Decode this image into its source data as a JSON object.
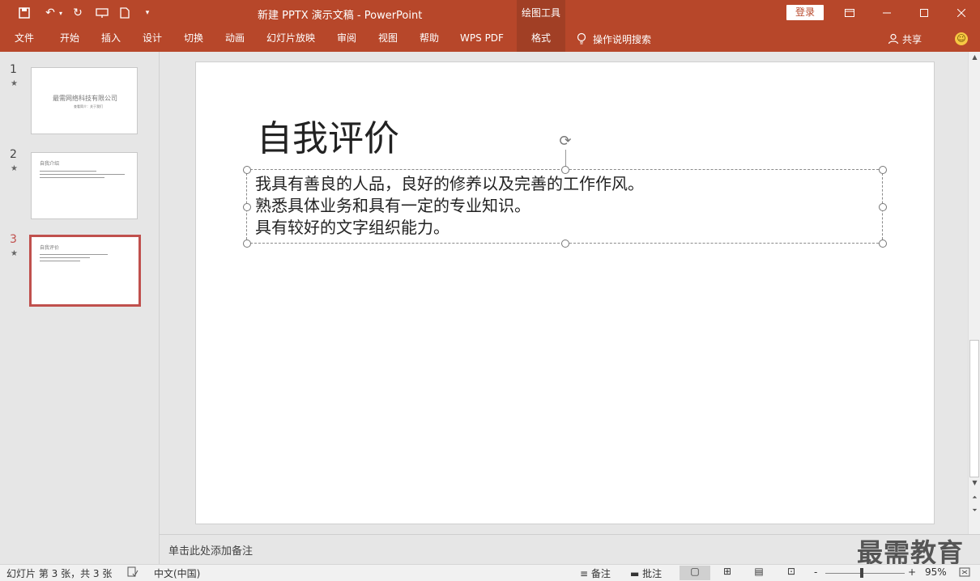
{
  "titlebar": {
    "title": "新建 PPTX 演示文稿 - PowerPoint",
    "context_tab": "绘图工具",
    "login": "登录",
    "quick_access": [
      "save-icon",
      "undo-icon",
      "redo-icon",
      "present-icon",
      "new-file-icon",
      "customize-icon"
    ],
    "window_buttons": [
      "ribbon-display-icon",
      "minimize-icon",
      "maximize-icon",
      "close-icon"
    ]
  },
  "ribbon": {
    "tabs": [
      "文件",
      "开始",
      "插入",
      "设计",
      "切换",
      "动画",
      "幻灯片放映",
      "审阅",
      "视图",
      "帮助",
      "WPS PDF",
      "格式"
    ],
    "search": "操作说明搜索",
    "share": "共享"
  },
  "thumbnails": [
    {
      "number": "1",
      "title": "最需网络科技有限公司",
      "subtitle": "查看简介：关于我们"
    },
    {
      "number": "2",
      "title": "自我介绍"
    },
    {
      "number": "3",
      "title": "自我评价"
    }
  ],
  "slide": {
    "title": "自我评价",
    "lines": [
      "我具有善良的人品，良好的修养以及完善的工作作风。",
      "熟悉具体业务和具有一定的专业知识。",
      "具有较好的文字组织能力。"
    ]
  },
  "notes": {
    "placeholder": "单击此处添加备注"
  },
  "watermark": "最需教育",
  "statusbar": {
    "slide_info": "幻灯片 第 3 张，共 3 张",
    "language": "中文(中国)",
    "notes": "备注",
    "comments": "批注",
    "zoom": "95%",
    "zoom_minus": "-",
    "zoom_plus": "+"
  },
  "colors": {
    "accent": "#b7472a",
    "selected_thumb": "#c0504d"
  }
}
